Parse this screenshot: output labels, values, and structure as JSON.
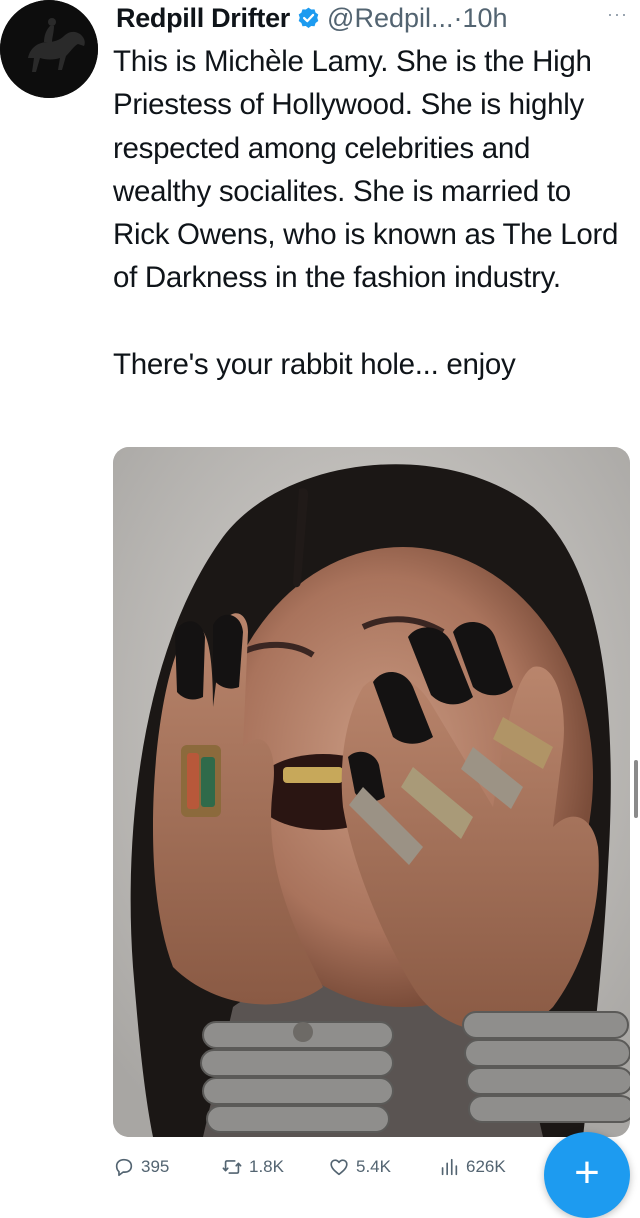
{
  "tweet": {
    "author_name": "Redpill Drifter",
    "handle": "@Redpil...",
    "separator": "·",
    "time": "10h",
    "more_icon": "more-icon",
    "verified_icon": "verified-badge-icon",
    "body_lines": [
      "This is Michèle Lamy. She is the High Priestess of Hollywood. She is highly respected among celebrities and wealthy socialites. She is married to Rick Owens, who is known as The Lord of Darkness in the fashion industry.",
      "There's your rabbit hole... enjoy"
    ],
    "media": {
      "type": "photo",
      "icon": "photo-image"
    }
  },
  "actions": {
    "reply": {
      "icon": "reply-icon",
      "count": "395"
    },
    "retweet": {
      "icon": "retweet-icon",
      "count": "1.8K"
    },
    "like": {
      "icon": "heart-icon",
      "count": "5.4K"
    },
    "views": {
      "icon": "views-icon",
      "count": "626K"
    }
  },
  "compose": {
    "icon": "plus-icon",
    "label": "+"
  },
  "colors": {
    "verified": "#1d9bf0",
    "fab": "#1d9bf0",
    "secondary_text": "#536471",
    "primary_text": "#0f1419"
  }
}
